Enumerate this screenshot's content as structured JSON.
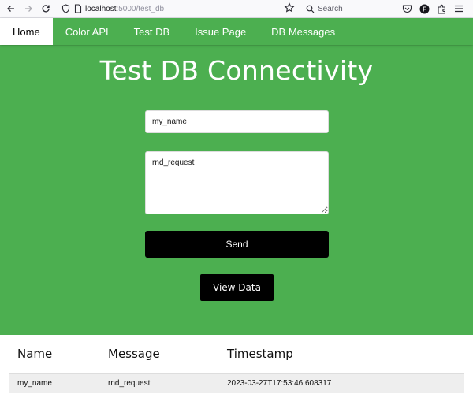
{
  "browser": {
    "url_host": "localhost",
    "url_rest": ":5000/test_db",
    "search_placeholder": "Search"
  },
  "nav": {
    "items": [
      {
        "label": "Home",
        "active": true
      },
      {
        "label": "Color API"
      },
      {
        "label": "Test DB"
      },
      {
        "label": "Issue Page"
      },
      {
        "label": "DB Messages"
      }
    ]
  },
  "main": {
    "title": "Test DB Connectivity",
    "name_value": "my_name",
    "request_value": "rnd_request",
    "send_label": "Send",
    "view_label": "View Data"
  },
  "table": {
    "headers": [
      "Name",
      "Message",
      "Timestamp"
    ],
    "rows": [
      [
        "my_name",
        "rnd_request",
        "2023-03-27T17:53:46.608317"
      ]
    ]
  },
  "colors": {
    "accent": "#4caf50",
    "button": "#000000"
  }
}
